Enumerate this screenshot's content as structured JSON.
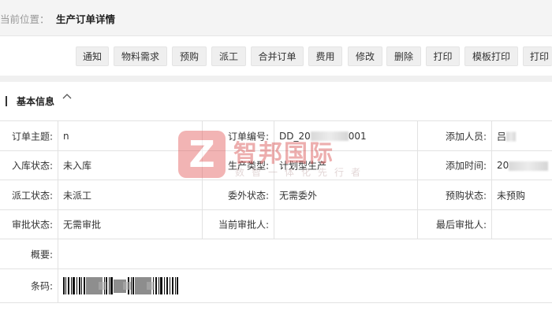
{
  "breadcrumb": {
    "label": "当前位置：",
    "current": "生产订单详情"
  },
  "toolbar": {
    "buttons": [
      "通知",
      "物料需求",
      "预购",
      "派工",
      "合并订单",
      "费用",
      "修改",
      "删除",
      "打印",
      "模板打印",
      "打印"
    ]
  },
  "section": {
    "title": "基本信息",
    "toggle_icon": "chevron-up-icon"
  },
  "fields": {
    "order_subject": {
      "label": "订单主题:",
      "value": "n"
    },
    "order_no": {
      "label": "订单编号:",
      "value_prefix": "DD_20",
      "value_suffix": "001"
    },
    "added_by": {
      "label": "添加人员:",
      "value": "吕"
    },
    "stock_status": {
      "label": "入库状态:",
      "value": "未入库"
    },
    "production_type": {
      "label": "生产类型:",
      "value": "计划型生产"
    },
    "added_time": {
      "label": "添加时间:",
      "value": "20"
    },
    "dispatch_status": {
      "label": "派工状态:",
      "value": "未派工"
    },
    "outsource_status": {
      "label": "委外状态:",
      "value": "无需委外"
    },
    "prepurchase_status": {
      "label": "预购状态:",
      "value": "未预购"
    },
    "approval_status": {
      "label": "审批状态:",
      "value": "无需审批"
    },
    "current_approver": {
      "label": "当前审批人:",
      "value": ""
    },
    "last_approver": {
      "label": "最后审批人:",
      "value": ""
    },
    "summary": {
      "label": "概要:",
      "value": ""
    },
    "barcode": {
      "label": "条码:"
    }
  },
  "watermark": {
    "name": "智邦国际",
    "slogan": "数智一体化先行者",
    "logo_letter": "Z"
  },
  "colors": {
    "watermark_red": "#e45a5a",
    "toolbar_button_bg": "#efefef",
    "border": "#e2e2e2"
  }
}
